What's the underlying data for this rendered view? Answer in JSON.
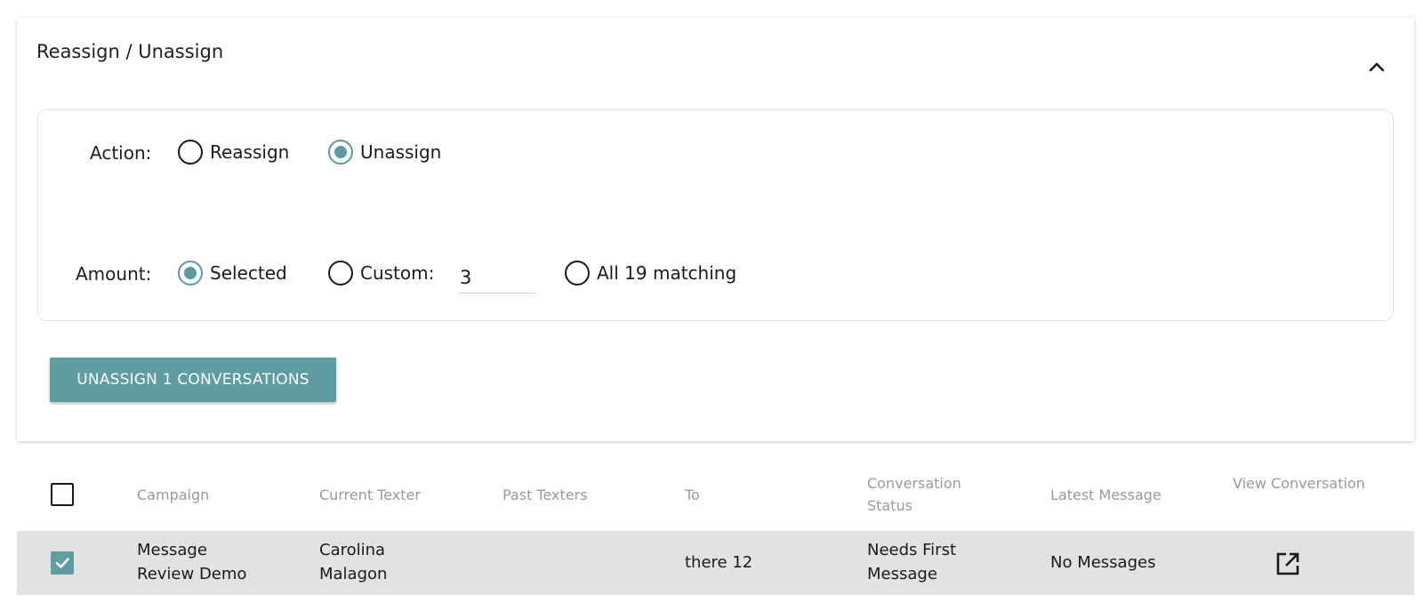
{
  "panel": {
    "title": "Reassign / Unassign",
    "collapse_icon": "chevron-up-icon"
  },
  "action": {
    "label": "Action:",
    "options": [
      {
        "label": "Reassign",
        "checked": false
      },
      {
        "label": "Unassign",
        "checked": true
      }
    ]
  },
  "amount": {
    "label": "Amount:",
    "selected_label": "Selected",
    "custom_label": "Custom:",
    "custom_value": "3",
    "all_label": "All 19 matching",
    "checked": "Selected"
  },
  "submit_button": "UNASSIGN 1 CONVERSATIONS",
  "table": {
    "columns": [
      "Campaign",
      "Current Texter",
      "Past Texters",
      "To",
      "Conversation Status",
      "Latest Message",
      "View Conversation"
    ],
    "rows": [
      {
        "selected": true,
        "campaign": "Message Review Demo",
        "current_texter": "Carolina Malagon",
        "past_texters": "",
        "to": "there 12",
        "status": "Needs First Message",
        "latest_message": "No Messages",
        "view_icon": "open-in-new-icon"
      }
    ]
  },
  "colors": {
    "accent": "#5e9da2",
    "row_highlight": "#e1e3e0",
    "header_text": "#9a9a9a"
  }
}
